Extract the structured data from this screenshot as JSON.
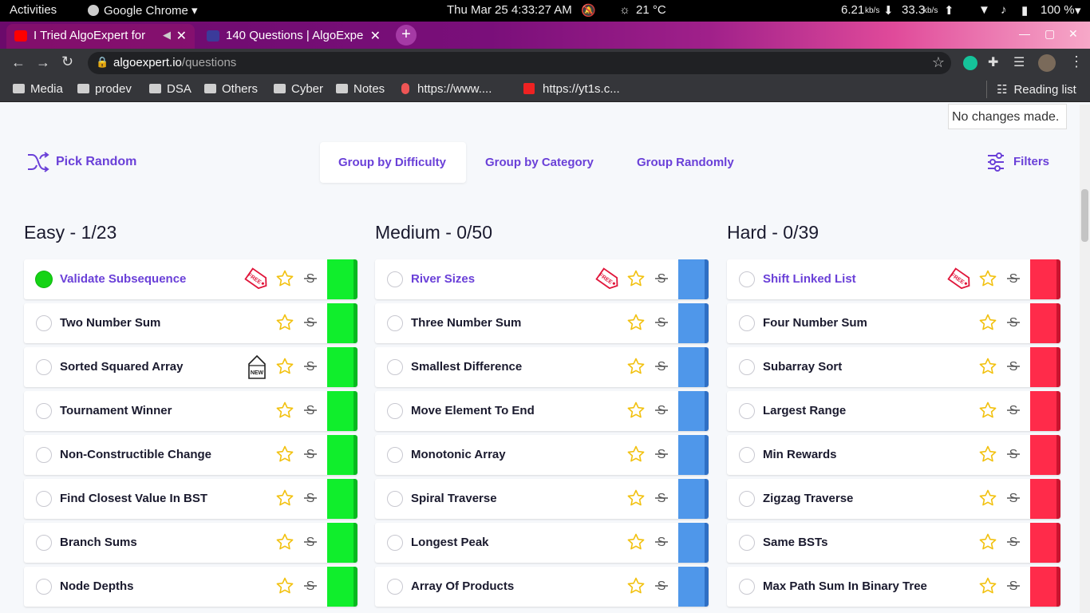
{
  "system_bar": {
    "activities": "Activities",
    "app": "Google Chrome",
    "datetime": "Thu Mar 25   4:33:27 AM",
    "weather": "21 °C",
    "net_down": "6.21",
    "net_down_unit": "kb/s",
    "net_up": "33.3",
    "net_up_unit": "kb/s",
    "battery": "100 %"
  },
  "tabs": [
    {
      "title": "I Tried AlgoExpert for",
      "favicon": "youtube-icon"
    },
    {
      "title": "140 Questions | AlgoExpe",
      "favicon": "algoexpert-icon"
    }
  ],
  "address_bar": {
    "host": "algoexpert.io",
    "path": "/questions"
  },
  "bookmarks": [
    {
      "label": "Media",
      "icon": "folder-icon"
    },
    {
      "label": "prodev",
      "icon": "folder-icon"
    },
    {
      "label": "DSA",
      "icon": "folder-icon"
    },
    {
      "label": "Others",
      "icon": "folder-icon"
    },
    {
      "label": "Cyber",
      "icon": "folder-icon"
    },
    {
      "label": "Notes",
      "icon": "folder-icon"
    },
    {
      "label": "https://www....",
      "icon": "site-icon"
    },
    {
      "label": "https://yt1s.c...",
      "icon": "download-icon"
    }
  ],
  "reading_list": "Reading list",
  "toast": "No changes made.",
  "controls": {
    "pick_random": "Pick Random",
    "group_difficulty": "Group by Difficulty",
    "group_category": "Group by Category",
    "group_randomly": "Group Randomly",
    "filters": "Filters"
  },
  "columns": [
    {
      "title": "Easy - 1/23",
      "color": "#10ee2c",
      "questions": [
        {
          "name": "Validate Subsequence",
          "completed": true,
          "tag": "FREE"
        },
        {
          "name": "Two Number Sum"
        },
        {
          "name": "Sorted Squared Array",
          "tag": "NEW"
        },
        {
          "name": "Tournament Winner"
        },
        {
          "name": "Non-Constructible Change"
        },
        {
          "name": "Find Closest Value In BST"
        },
        {
          "name": "Branch Sums"
        },
        {
          "name": "Node Depths"
        }
      ]
    },
    {
      "title": "Medium - 0/50",
      "color": "#4f97ea",
      "questions": [
        {
          "name": "River Sizes",
          "tag": "FREE"
        },
        {
          "name": "Three Number Sum"
        },
        {
          "name": "Smallest Difference"
        },
        {
          "name": "Move Element To End"
        },
        {
          "name": "Monotonic Array"
        },
        {
          "name": "Spiral Traverse"
        },
        {
          "name": "Longest Peak"
        },
        {
          "name": "Array Of Products"
        }
      ]
    },
    {
      "title": "Hard - 0/39",
      "color": "#ff2b4a",
      "questions": [
        {
          "name": "Shift Linked List",
          "tag": "FREE"
        },
        {
          "name": "Four Number Sum"
        },
        {
          "name": "Subarray Sort"
        },
        {
          "name": "Largest Range"
        },
        {
          "name": "Min Rewards"
        },
        {
          "name": "Zigzag Traverse"
        },
        {
          "name": "Same BSTs"
        },
        {
          "name": "Max Path Sum In Binary Tree"
        }
      ]
    }
  ]
}
